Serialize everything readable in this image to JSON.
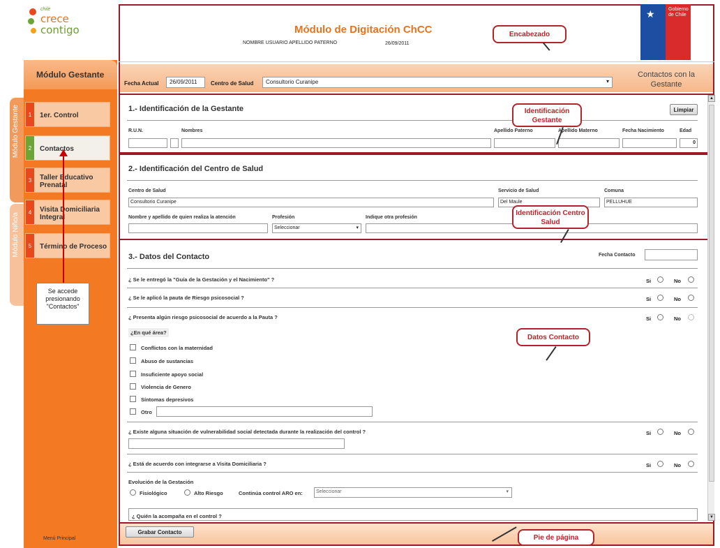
{
  "logo": {
    "line0": "chile",
    "line1": "crece",
    "line2": "contigo"
  },
  "sidebar": {
    "title": "Módulo Gestante",
    "items": [
      {
        "num": "1",
        "label": "1er. Control"
      },
      {
        "num": "2",
        "label": "Contactos"
      },
      {
        "num": "3",
        "label": "Taller Educativo Prenatal"
      },
      {
        "num": "4",
        "label": "Visita Domiciliaria Integral"
      },
      {
        "num": "5",
        "label": "Término de Proceso"
      }
    ],
    "vtab_gestante": "Módulo Gestante",
    "vtab_nino": "Módulo Niño/a",
    "callout": "Se accede presionando \"Contactos\"",
    "menu_principal": "Menú Principal"
  },
  "header": {
    "title": "Módulo de Digitación ChCC",
    "user": "NOMBRE USUARIO APELLIDO PATERNO",
    "date": "26/09/2011",
    "gov": "Gobierno de Chile",
    "callout": "Encabezado"
  },
  "toolbar": {
    "fecha_label": "Fecha Actual",
    "fecha_value": "26/09/2011",
    "centro_label": "Centro de Salud",
    "centro_value": "Consultorio Curanipe",
    "right_title": "Contactos con la Gestante"
  },
  "section1": {
    "title": "1.- Identificación de la Gestante",
    "limpiar": "Limpiar",
    "run": "R.U.N.",
    "nombres": "Nombres",
    "ap_paterno": "Apellido Paterno",
    "ap_materno": "Apellido Materno",
    "fecha_nac": "Fecha Nacimiento",
    "edad": "Edad",
    "edad_value": "0",
    "callout": "Identificación Gestante"
  },
  "section2": {
    "title": "2.- Identificación del Centro de Salud",
    "centro_label": "Centro de Salud",
    "centro_value": "Consultorio Curanipe",
    "servicio_label": "Servicio de Salud",
    "servicio_value": "Del Maule",
    "comuna_label": "Comuna",
    "comuna_value": "PELLUHUE",
    "nombre_label": "Nombre y apellido de quien realiza la atención",
    "profesion_label": "Profesión",
    "profesion_value": "Seleccionar",
    "otra_label": "Indique otra profesión",
    "callout": "Identificación Centro Salud"
  },
  "section3": {
    "title": "3.- Datos del Contacto",
    "fecha_contacto": "Fecha Contacto",
    "q1": "¿ Se le entregó la \"Guía de la Gestación y el Nacimiento\" ?",
    "q2": "¿ Se le aplicó la pauta de Riesgo psicosocial ?",
    "q3": "¿ Presenta algún riesgo psicosocial de acuerdo a la Pauta ?",
    "area": "¿En qué área?",
    "checks": [
      "Conflictos con la maternidad",
      "Abuso de sustancias",
      "Insuficiente apoyo social",
      "Violencia de Genero",
      "Síntomas depresivos",
      "Otro"
    ],
    "q4": "¿ Existe alguna situación de vulnerabilidad social detectada durante la realización del control ?",
    "q5": "¿ Está de acuerdo con integrarse a Visita Domiciliaria ?",
    "evolucion": "Evolución de la Gestación",
    "fisiologico": "Fisiológico",
    "alto_riesgo": "Alto Riesgo",
    "continua": "Continúa control ARO en:",
    "continua_value": "Seleccionar",
    "q6": "¿ Quién la acompaña en el control ?",
    "si": "Si",
    "no": "No",
    "callout": "Datos Contacto"
  },
  "footer": {
    "grabar": "Grabar Contacto",
    "callout": "Pie de página"
  }
}
